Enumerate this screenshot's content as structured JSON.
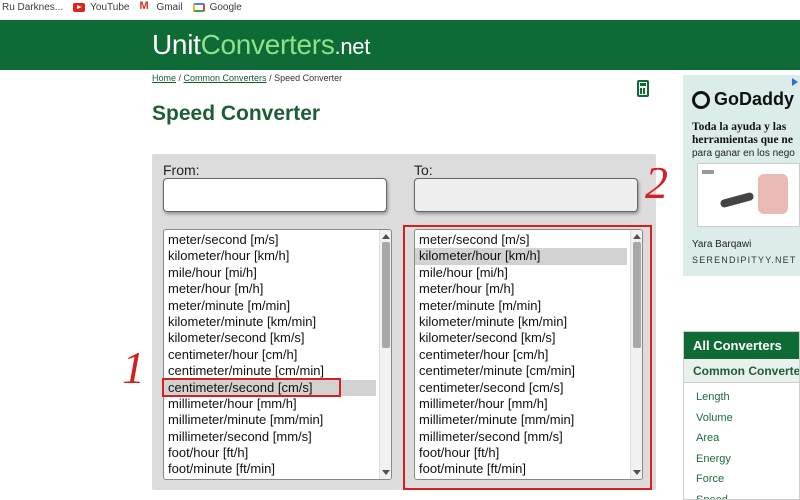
{
  "bookmarks": [
    {
      "label": "Ru Darknes...",
      "icon": "page-icon"
    },
    {
      "label": "YouTube",
      "icon": "youtube-icon"
    },
    {
      "label": "Gmail",
      "icon": "gmail-icon"
    },
    {
      "label": "Google",
      "icon": "google-icon"
    }
  ],
  "header": {
    "logo_a": "Unit",
    "logo_b": "Converters",
    "logo_c": ".net",
    "bg": "#0e6b35"
  },
  "breadcrumb": {
    "home": "Home",
    "sep1": " / ",
    "common": "Common Converters",
    "sep2": " / ",
    "current": "Speed Converter"
  },
  "page_title": "Speed Converter",
  "converter": {
    "from_label": "From:",
    "to_label": "To:",
    "from_value": "",
    "to_value": "",
    "from_units": [
      "meter/second [m/s]",
      "kilometer/hour [km/h]",
      "mile/hour [mi/h]",
      "meter/hour [m/h]",
      "meter/minute [m/min]",
      "kilometer/minute [km/min]",
      "kilometer/second [km/s]",
      "centimeter/hour [cm/h]",
      "centimeter/minute [cm/min]",
      "centimeter/second [cm/s]",
      "millimeter/hour [mm/h]",
      "millimeter/minute [mm/min]",
      "millimeter/second [mm/s]",
      "foot/hour [ft/h]",
      "foot/minute [ft/min]"
    ],
    "from_selected": "centimeter/second [cm/s]",
    "to_units": [
      "meter/second [m/s]",
      "kilometer/hour [km/h]",
      "mile/hour [mi/h]",
      "meter/hour [m/h]",
      "meter/minute [m/min]",
      "kilometer/minute [km/min]",
      "kilometer/second [km/s]",
      "centimeter/hour [cm/h]",
      "centimeter/minute [cm/min]",
      "centimeter/second [cm/s]",
      "millimeter/hour [mm/h]",
      "millimeter/minute [mm/min]",
      "millimeter/second [mm/s]",
      "foot/hour [ft/h]",
      "foot/minute [ft/min]"
    ],
    "to_selected": "kilometer/hour [km/h]"
  },
  "annotations": {
    "step1": "1",
    "step2": "2",
    "color": "#d42020"
  },
  "ad": {
    "brand": "GoDaddy",
    "line1": "Toda la ayuda y las",
    "line2": "herramientas que ne",
    "sub": "para ganar en los nego",
    "person": "Yara Barqawi",
    "site": "SERENDIPITYY.NET"
  },
  "sidebar": {
    "heading": "All Converters",
    "subheading": "Common Converte",
    "items": [
      "Length",
      "Volume",
      "Area",
      "Energy",
      "Force",
      "Speed"
    ]
  }
}
